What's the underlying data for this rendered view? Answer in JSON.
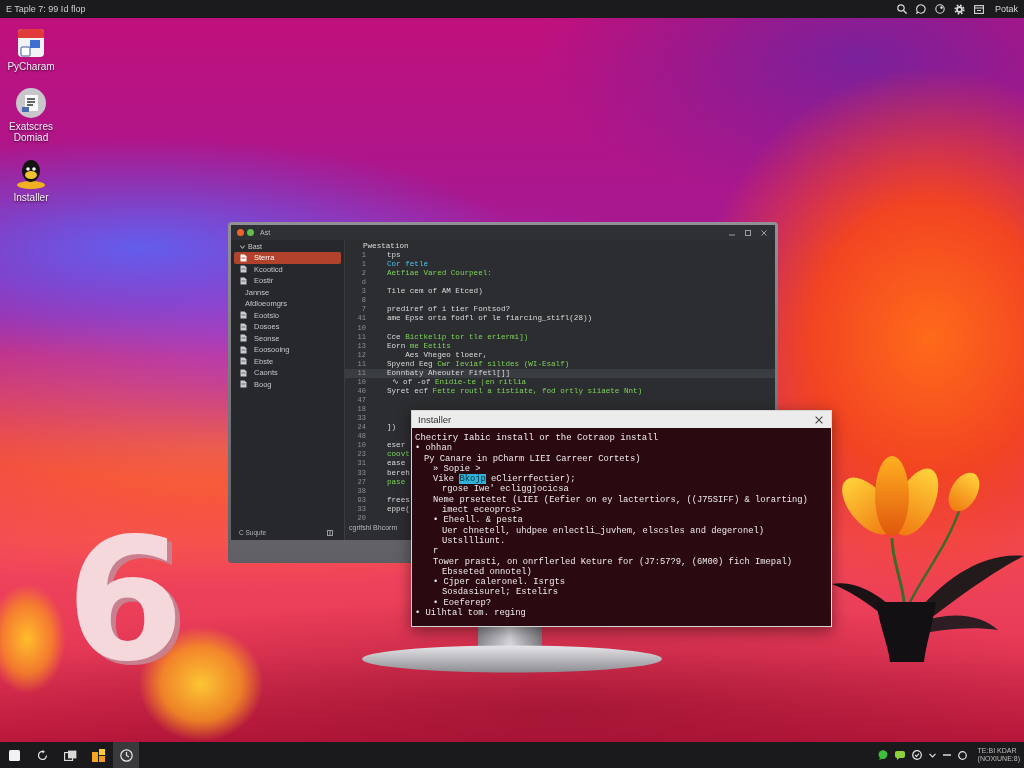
{
  "top_bar": {
    "title": "E Taple 7: 99 Id flop",
    "user": "Potak"
  },
  "desktop_icons": [
    {
      "label": "PyCharam"
    },
    {
      "label": "Exatscres Domiad"
    },
    {
      "label": "Installer"
    }
  ],
  "ide": {
    "title": "Ast",
    "sidebar": {
      "header": "Bast",
      "items": [
        {
          "label": "Sterra",
          "kind": "file",
          "selected": true
        },
        {
          "label": "Kcooticd",
          "kind": "file",
          "selected": false
        },
        {
          "label": "Eostir",
          "kind": "file",
          "selected": false
        },
        {
          "label": "Jannse",
          "kind": "text",
          "selected": false
        },
        {
          "label": "Afdloeomgrs",
          "kind": "text",
          "selected": false
        },
        {
          "label": "Eootsio",
          "kind": "file",
          "selected": false
        },
        {
          "label": "Dosoes",
          "kind": "file",
          "selected": false
        },
        {
          "label": "Seonse",
          "kind": "file",
          "selected": false
        },
        {
          "label": "Eoosooing",
          "kind": "file",
          "selected": false
        },
        {
          "label": "Ebste",
          "kind": "file",
          "selected": false
        },
        {
          "label": "Caonts",
          "kind": "file",
          "selected": false
        },
        {
          "label": "Boog",
          "kind": "file",
          "selected": false
        }
      ],
      "footer": "C Suqute"
    },
    "editor": {
      "tab_title": "Pwestation",
      "lines": [
        {
          "number": "1",
          "current": false,
          "parts": [
            {
              "kind": "plain",
              "text": "tps"
            }
          ]
        },
        {
          "number": "1",
          "current": false,
          "parts": [
            {
              "kind": "keyword",
              "text": "Cor fetle"
            }
          ]
        },
        {
          "number": "2",
          "current": false,
          "parts": [
            {
              "kind": "string",
              "text": "Aetfiae Vared Courpeel:"
            }
          ]
        },
        {
          "number": "d",
          "current": false
        },
        {
          "number": "3",
          "current": false,
          "parts": [
            {
              "kind": "plain",
              "text": "Tile cem of AM Etced)"
            }
          ]
        },
        {
          "number": "8",
          "current": false
        },
        {
          "number": "7",
          "current": false,
          "parts": [
            {
              "kind": "plain",
              "text": "prediref of i tier Fontsod?"
            }
          ]
        },
        {
          "number": "41",
          "current": false,
          "parts": [
            {
              "kind": "plain",
              "text": "ame Epse orta fodfl of le fiarcing_stifl(28))"
            }
          ]
        },
        {
          "number": "10",
          "current": false
        },
        {
          "number": "11",
          "current": false,
          "parts": [
            {
              "kind": "plain",
              "text": "Cce "
            },
            {
              "kind": "string",
              "text": "Bictkelip tor tle eriermi])"
            }
          ]
        },
        {
          "number": "13",
          "current": false,
          "parts": [
            {
              "kind": "plain",
              "text": "Eorn "
            },
            {
              "kind": "string",
              "text": "me Eetits"
            }
          ]
        },
        {
          "number": "12",
          "current": false,
          "parts": [
            {
              "kind": "plain",
              "text": "    Aes Vhegeo tloeer,"
            }
          ]
        },
        {
          "number": "11",
          "current": false,
          "parts": [
            {
              "kind": "plain",
              "text": "Spyend Eeg "
            },
            {
              "kind": "string",
              "text": "Cwr Ieviaf siltdes (WI-Esalf)"
            }
          ]
        },
        {
          "number": "11",
          "current": true,
          "parts": [
            {
              "kind": "plain",
              "text": "Eonnbaty Aheouter Fifetl[]]"
            }
          ]
        },
        {
          "number": "10",
          "current": false,
          "parts": [
            {
              "kind": "plain",
              "text": " ∿ of -of "
            },
            {
              "kind": "string",
              "text": "Enidie-te |en ritlia"
            }
          ]
        },
        {
          "number": "40",
          "current": false,
          "parts": [
            {
              "kind": "plain",
              "text": "Syret ecf "
            },
            {
              "kind": "string",
              "text": "Fette routl a tistiate, fod ortly siiaete Nnt)"
            }
          ]
        },
        {
          "number": "47",
          "current": false
        },
        {
          "number": "18",
          "current": false
        },
        {
          "number": "33",
          "current": false
        },
        {
          "number": "24",
          "current": false,
          "parts": [
            {
              "kind": "plain",
              "text": "])"
            }
          ]
        },
        {
          "number": "48",
          "current": false
        },
        {
          "number": "10",
          "current": false,
          "parts": [
            {
              "kind": "plain",
              "text": "eser"
            }
          ]
        },
        {
          "number": "23",
          "current": false,
          "parts": [
            {
              "kind": "string",
              "text": "coovt"
            }
          ]
        },
        {
          "number": "31",
          "current": false,
          "parts": [
            {
              "kind": "plain",
              "text": "ease"
            }
          ]
        },
        {
          "number": "33",
          "current": false,
          "parts": [
            {
              "kind": "plain",
              "text": "bereh"
            }
          ]
        },
        {
          "number": "27",
          "current": false,
          "parts": [
            {
              "kind": "string",
              "text": "pase"
            }
          ]
        },
        {
          "number": "38",
          "current": false
        },
        {
          "number": "93",
          "current": false,
          "parts": [
            {
              "kind": "plain",
              "text": "frees"
            }
          ]
        },
        {
          "number": "33",
          "current": false,
          "parts": [
            {
              "kind": "plain",
              "text": "eppe("
            }
          ]
        },
        {
          "number": "20",
          "current": false
        }
      ],
      "status": "cgrifshl Bhcorm"
    }
  },
  "installer": {
    "title": "Installer",
    "lines": [
      {
        "text": "Chectiry Iabic install or the Cotraop install"
      },
      {
        "text": "• ohhan",
        "children": [
          {
            "text": "Py Canare in pCharm LIEI Carreer Cortets)",
            "children": [
              {
                "text": "» Sopie >"
              },
              {
                "parts": [
                  {
                    "text": "Vike ",
                    "highlighted": false
                  },
                  {
                    "text": "Bkojp",
                    "highlighted": true
                  },
                  {
                    "text": " eClierrfectier);",
                    "highlighted": false
                  }
                ],
                "children": [
                  {
                    "text": "rgose Iwe' ecliggjocicsa"
                  }
                ]
              },
              {
                "text": "Neme prsetetet (LIEI (Eefier on ey lactertiors, ((J75SIFF) & lorarting)",
                "children": [
                  {
                    "text": "imect eceoprcs>"
                  }
                ]
              },
              {
                "text": "• Eheell. & pesta",
                "children": [
                  {
                    "text": "Uer chnetell, uhdpee enlectli_juvhem, elscsles and degeronel)"
                  },
                  {
                    "text": "Ustsllliunt."
                  }
                ]
              },
              {
                "text": "r"
              },
              {
                "text": "Tower prasti, on onrflerled Keture for (J7:57?9, (6M00) fich Imepal)",
                "children": [
                  {
                    "text": "Ebsseted onnotel)"
                  }
                ]
              },
              {
                "text": "• Cjper caleronel. Isrgts",
                "children": [
                  {
                    "text": "Sosdasisurel; Estelirs"
                  }
                ]
              },
              {
                "text": "• Eoeferep?"
              }
            ]
          }
        ]
      },
      {
        "text": "• Uilhtal tom. reging"
      }
    ]
  },
  "taskbar": {
    "apps": [
      {
        "selected": false
      },
      {
        "selected": false
      },
      {
        "selected": false
      },
      {
        "selected": false
      },
      {
        "selected": true
      }
    ],
    "clock": {
      "time": "TE:BI KDAR",
      "date": "(NOXIUNE:8)"
    }
  },
  "wallpaper": {
    "sculpture": "6"
  }
}
